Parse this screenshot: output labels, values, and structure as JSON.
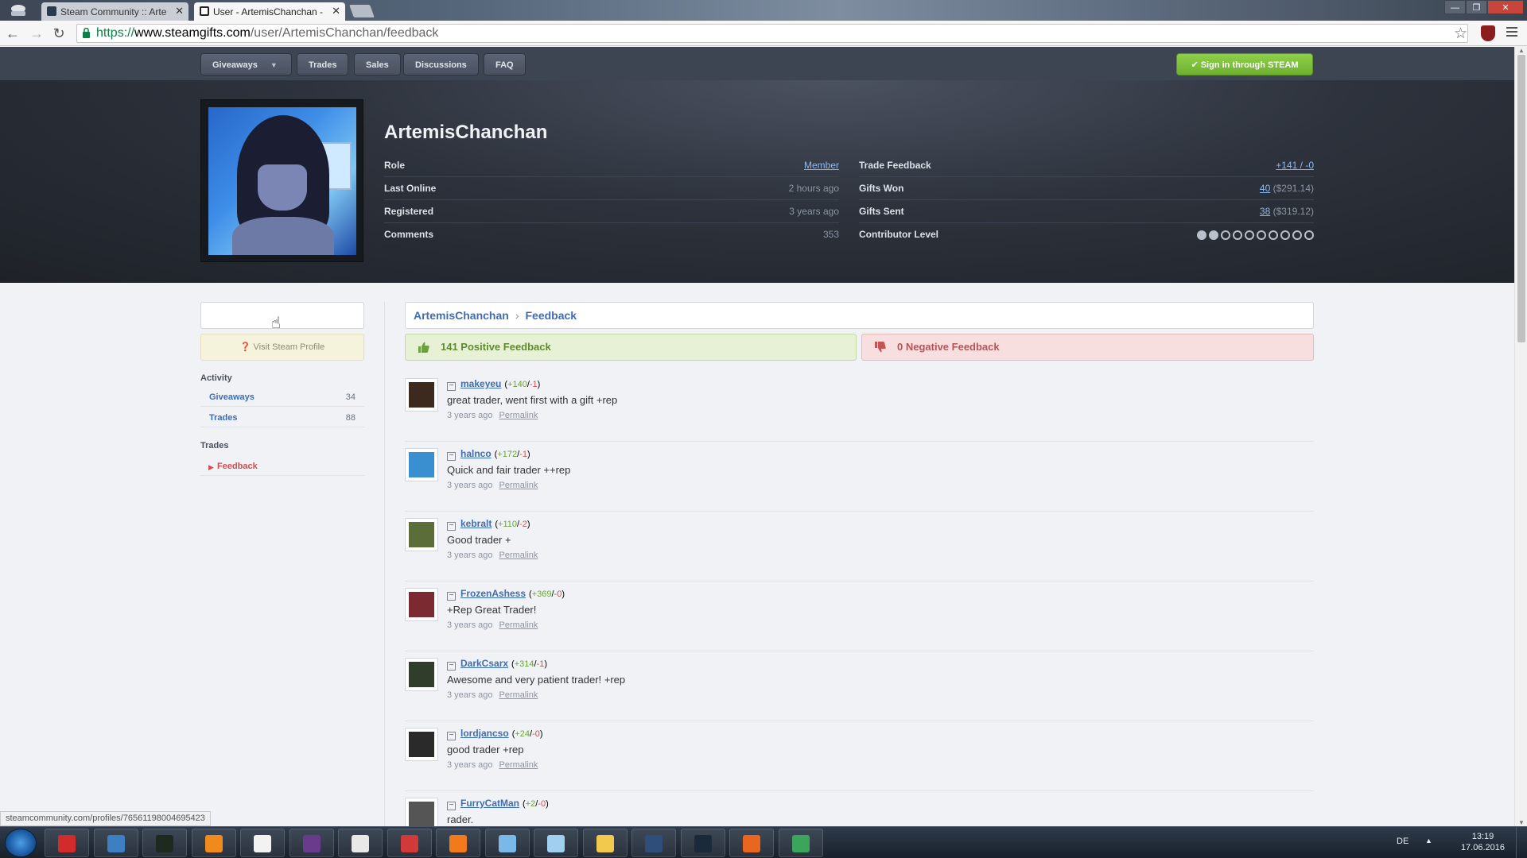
{
  "browser": {
    "tabs": [
      {
        "title": "Steam Community :: Arte",
        "active": false
      },
      {
        "title": "User - ArtemisChanchan -",
        "active": true
      }
    ],
    "url": {
      "protocol": "https://",
      "host": "www.steamgifts.com",
      "path": "/user/ArtemisChanchan/feedback"
    },
    "status_url": "steamcommunity.com/profiles/76561198004695423"
  },
  "nav": {
    "items": [
      "Giveaways",
      "Trades",
      "Sales",
      "Discussions",
      "FAQ"
    ],
    "signin_label": "Sign in through STEAM"
  },
  "profile": {
    "username": "ArtemisChanchan",
    "left_stats": [
      {
        "label": "Role",
        "value": "Member",
        "link": true
      },
      {
        "label": "Last Online",
        "value": "2 hours ago",
        "link": false
      },
      {
        "label": "Registered",
        "value": "3 years ago",
        "link": false
      },
      {
        "label": "Comments",
        "value": "353",
        "link": false
      }
    ],
    "trade_feedback": {
      "label": "Trade Feedback",
      "value": "+141 / -0"
    },
    "gifts_won": {
      "label": "Gifts Won",
      "count": "40",
      "amount": "($291.14)"
    },
    "gifts_sent": {
      "label": "Gifts Sent",
      "count": "38",
      "amount": "($319.12)"
    },
    "contributor": {
      "label": "Contributor Level",
      "level": 2,
      "max": 10
    }
  },
  "sidebar": {
    "visit_steam_label": "Visit Steam Profile",
    "activity_heading": "Activity",
    "activity_items": [
      {
        "label": "Giveaways",
        "count": "34"
      },
      {
        "label": "Trades",
        "count": "88"
      }
    ],
    "trades_heading": "Trades",
    "trades_items": [
      {
        "label": "Feedback",
        "selected": true
      }
    ]
  },
  "breadcrumb": {
    "user": "ArtemisChanchan",
    "page": "Feedback"
  },
  "feedback_summary": {
    "positive": "141 Positive Feedback",
    "negative": "0 Negative Feedback"
  },
  "comments": [
    {
      "user": "makeyeu",
      "pos": "+140",
      "neg": "-1",
      "text": "great trader, went first with a gift +rep",
      "time": "3 years ago",
      "color": "#3d2a1f"
    },
    {
      "user": "halnco",
      "pos": "+172",
      "neg": "-1",
      "text": "Quick and fair trader ++rep",
      "time": "3 years ago",
      "color": "#3a8fd0"
    },
    {
      "user": "kebralt",
      "pos": "+110",
      "neg": "-2",
      "text": "Good trader +",
      "time": "3 years ago",
      "color": "#5b6e3a"
    },
    {
      "user": "FrozenAshess",
      "pos": "+369",
      "neg": "-0",
      "text": "+Rep Great Trader!",
      "time": "3 years ago",
      "color": "#7a2a30"
    },
    {
      "user": "DarkCsarx",
      "pos": "+314",
      "neg": "-1",
      "text": "Awesome and very patient trader! +rep",
      "time": "3 years ago",
      "color": "#2f3d2a"
    },
    {
      "user": "lordjancso",
      "pos": "+24",
      "neg": "-0",
      "text": "good trader +rep",
      "time": "3 years ago",
      "color": "#2a2a2a"
    },
    {
      "user": "FurryCatMan",
      "pos": "+2",
      "neg": "-0",
      "text": "rader.",
      "time": "",
      "color": "#555555"
    }
  ],
  "permalink_label": "Permalink",
  "taskbar": {
    "apps": [
      {
        "name": "antivirus",
        "color": "#d22b2b"
      },
      {
        "name": "thunderbird",
        "color": "#3c7fc2"
      },
      {
        "name": "terminal",
        "color": "#1f2a1f"
      },
      {
        "name": "vlc",
        "color": "#f08a1c"
      },
      {
        "name": "notepad",
        "color": "#f2f2f2"
      },
      {
        "name": "tex",
        "color": "#6a3a8c"
      },
      {
        "name": "qr",
        "color": "#e8e8e8"
      },
      {
        "name": "mail",
        "color": "#d23a3a"
      },
      {
        "name": "sync",
        "color": "#f27a1a"
      },
      {
        "name": "calculator",
        "color": "#7ab8e8"
      },
      {
        "name": "cloud",
        "color": "#9fd0f0"
      },
      {
        "name": "explorer",
        "color": "#f2c94c"
      },
      {
        "name": "teamspeak",
        "color": "#2f4e7a"
      },
      {
        "name": "steam",
        "color": "#1a2a3a"
      },
      {
        "name": "firefox",
        "color": "#e8661e"
      },
      {
        "name": "chrome",
        "color": "#3ba55c"
      }
    ],
    "lang": "DE",
    "time": "13:19",
    "date": "17.06.2016"
  }
}
